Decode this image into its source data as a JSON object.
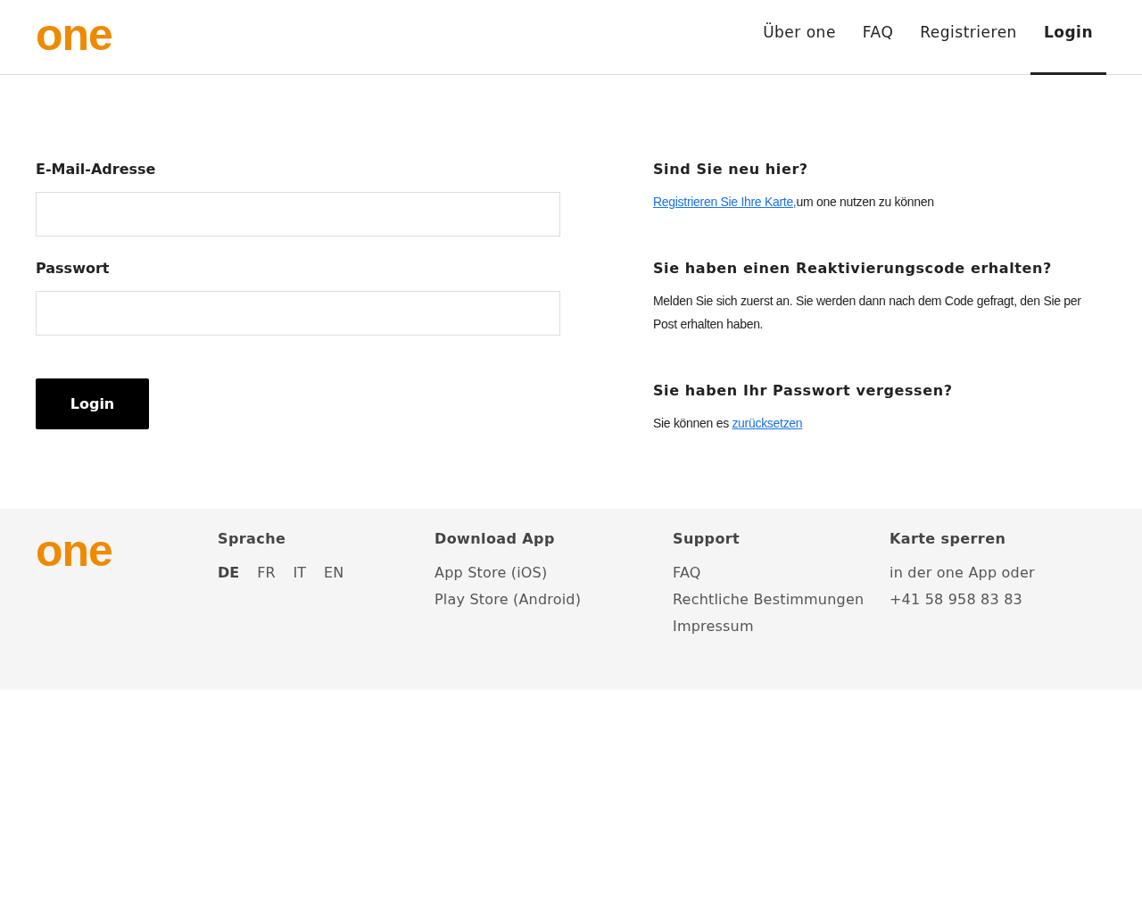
{
  "header": {
    "logo": "one",
    "nav": [
      {
        "label": "Über one",
        "selected": false
      },
      {
        "label": "FAQ",
        "selected": false
      },
      {
        "label": "Registrieren",
        "selected": false
      },
      {
        "label": "Login",
        "selected": true
      }
    ]
  },
  "login_form": {
    "fields": [
      {
        "label": "E-Mail-Adresse"
      },
      {
        "label": "Passwort"
      }
    ],
    "button": "Login"
  },
  "info": [
    {
      "heading": "Sind Sie neu hier?",
      "parts": [
        {
          "kind": "link",
          "text": "Registrieren Sie Ihre Karte,"
        },
        {
          "kind": "text",
          "text": "um one nutzen zu können"
        }
      ]
    },
    {
      "heading": "Sie haben einen Reaktivierungscode erhalten?",
      "parts": [
        {
          "kind": "text",
          "text": "Melden Sie sich zuerst an. Sie werden dann nach dem Code gefragt, den Sie per Post erhalten haben."
        }
      ]
    },
    {
      "heading": "Sie haben Ihr Passwort vergessen?",
      "parts": [
        {
          "kind": "text",
          "text": "Sie können es "
        },
        {
          "kind": "link",
          "text": "zurücksetzen"
        }
      ]
    }
  ],
  "footer": {
    "logo": "one",
    "language": {
      "title": "Sprache",
      "options": [
        {
          "label": "DE",
          "selected": true
        },
        {
          "label": "FR",
          "selected": false
        },
        {
          "label": "IT",
          "selected": false
        },
        {
          "label": "EN",
          "selected": false
        }
      ]
    },
    "columns": [
      {
        "title": "Download App",
        "items": [
          "App Store (iOS)",
          "Play Store (Android)"
        ]
      },
      {
        "title": "Support",
        "items": [
          "FAQ",
          "Rechtliche Bestimmungen",
          "Impressum"
        ]
      },
      {
        "title": "Karte sperren",
        "items": [
          "in der one App oder",
          "+41 58 958 83 83"
        ]
      }
    ]
  }
}
